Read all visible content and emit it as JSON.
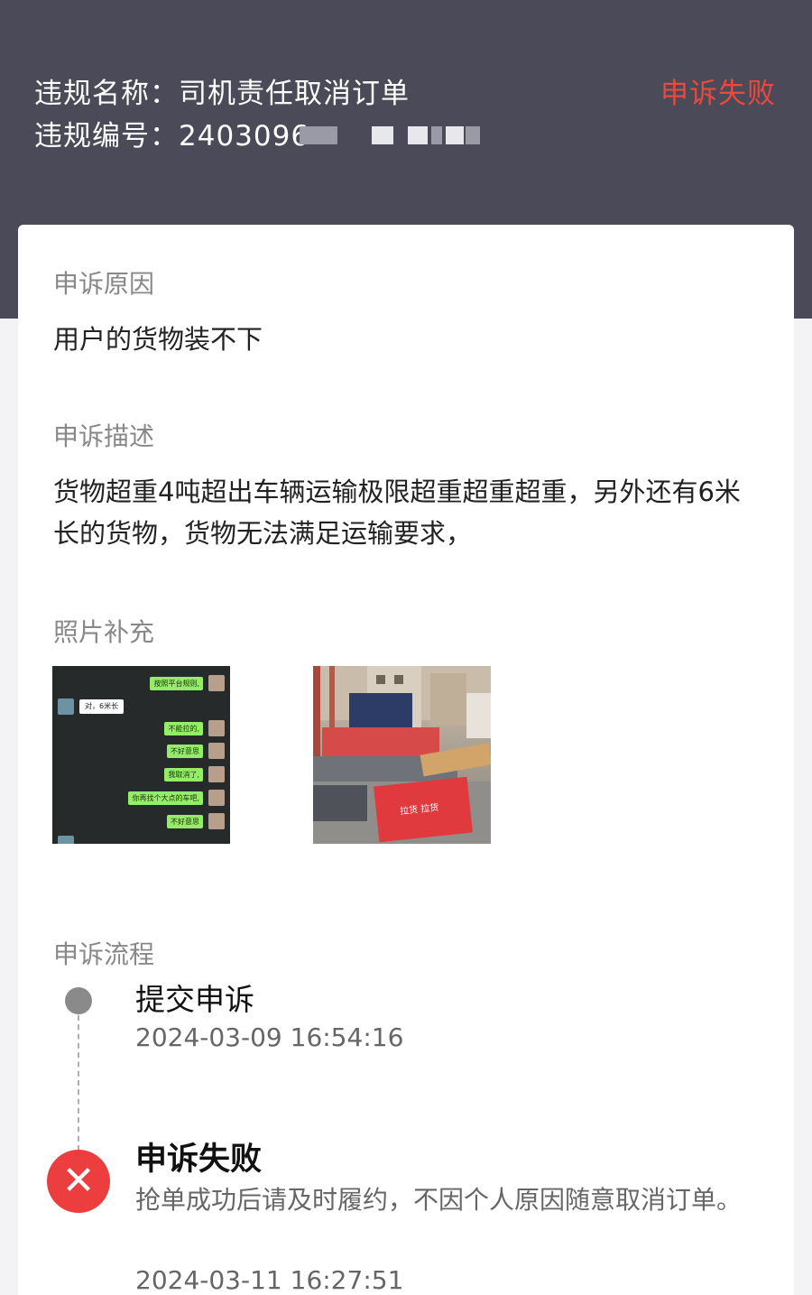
{
  "header": {
    "violation_name": "违规名称：司机责任取消订单",
    "violation_no": "违规编号：2403096",
    "status": "申诉失败"
  },
  "appeal": {
    "reason_title": "申诉原因",
    "reason": "用户的货物装不下",
    "description_title": "申诉描述",
    "description": "货物超重4吨超出车辆运输极限超重超重超重，另外还有6米长的货物，货物无法满足运输要求，",
    "photos_title": "照片补充",
    "chat_lines": [
      "按照平台规则,",
      "对，6米长",
      "不能拉的,",
      "不好意思",
      "我取消了,",
      "你再找个大点的车吧,",
      "不好意思"
    ],
    "banner_text": "拉货 拉货"
  },
  "process": {
    "title": "申诉流程",
    "steps": [
      {
        "title": "提交申诉",
        "time": "2024-03-09 16:54:16"
      },
      {
        "title": "申诉失败",
        "desc": "抢单成功后请及时履约，不因个人原因随意取消订单。",
        "time": "2024-03-11 16:27:51"
      }
    ]
  },
  "colors": {
    "header_bg": "#4a4a58",
    "status_red": "#e84a3d",
    "fail_icon_bg": "#ec3e3e"
  }
}
